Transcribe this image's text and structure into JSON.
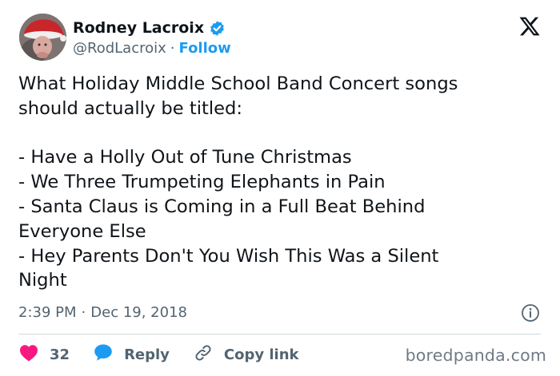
{
  "author": {
    "display_name": "Rodney Lacroix",
    "handle": "@RodLacroix",
    "separator": "·",
    "follow_label": "Follow"
  },
  "tweet": {
    "lines": [
      "What Holiday Middle School Band Concert songs",
      "should actually be titled:",
      "",
      "- Have a Holly Out of Tune Christmas",
      "- We Three Trumpeting Elephants in Pain",
      "- Santa Claus is Coming in a Full Beat Behind",
      "Everyone Else",
      "- Hey Parents Don't You Wish This Was a Silent",
      "Night"
    ],
    "time": "2:39 PM",
    "separator": "·",
    "date": "Dec 19, 2018"
  },
  "actions": {
    "like_count": "32",
    "reply_label": "Reply",
    "copy_link_label": "Copy link"
  },
  "watermark": "boredpanda.com",
  "icons": {
    "verified": "verified-badge-icon",
    "logo": "x-logo-icon",
    "info": "info-icon",
    "like": "heart-icon",
    "reply": "speech-bubble-icon",
    "copy": "link-icon"
  },
  "colors": {
    "accent": "#1d9bf0",
    "like": "#f91880",
    "text": "#0f1419",
    "secondary": "#536471",
    "divider": "#cfd9de"
  }
}
